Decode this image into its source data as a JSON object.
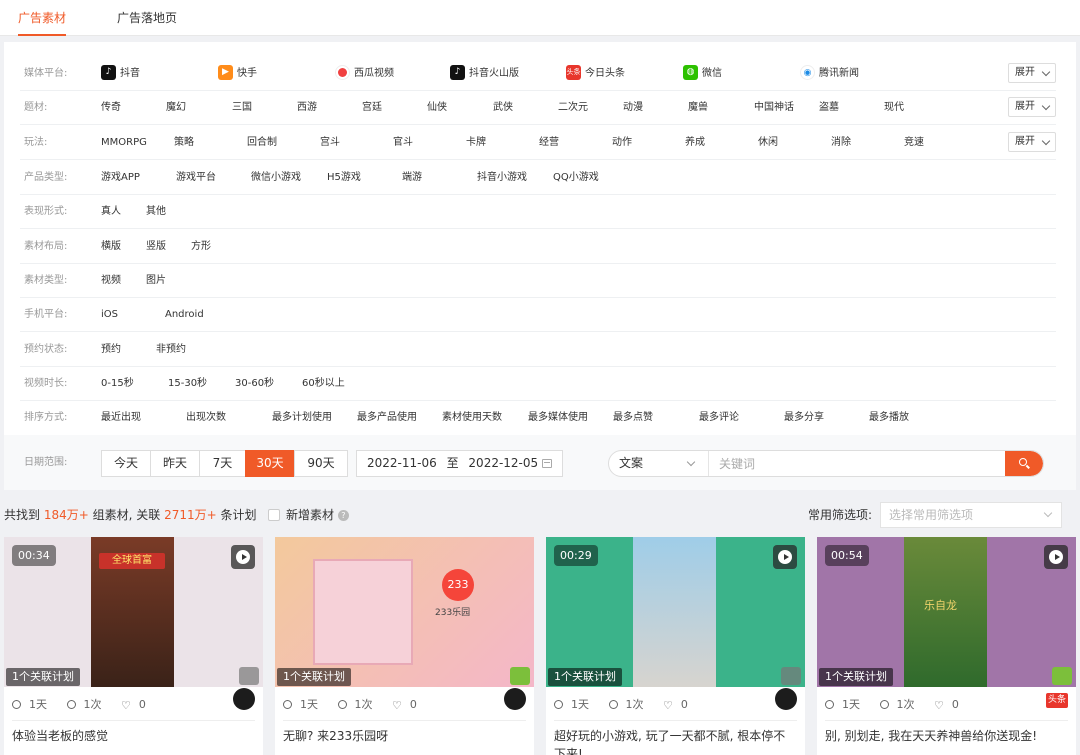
{
  "tabs": [
    {
      "label": "广告素材",
      "active": true
    },
    {
      "label": "广告落地页",
      "active": false
    }
  ],
  "filters": {
    "expand_label": "展开",
    "rows": [
      {
        "label": "媒体平台:",
        "options": [
          "抖音",
          "快手",
          "西瓜视频",
          "抖音火山版",
          "今日头条",
          "微信",
          "腾讯新闻"
        ],
        "icons": [
          "douyin-icon",
          "kuaishou-icon",
          "xigua-icon",
          "huoshan-icon",
          "toutiao-icon",
          "wechat-icon",
          "tencent-news-icon"
        ],
        "expandable": true
      },
      {
        "label": "题材:",
        "options": [
          "传奇",
          "魔幻",
          "三国",
          "西游",
          "宫廷",
          "仙侠",
          "武侠",
          "二次元",
          "动漫",
          "魔兽",
          "中国神话",
          "盗墓",
          "现代"
        ],
        "expandable": true
      },
      {
        "label": "玩法:",
        "options": [
          "MMORPG",
          "策略",
          "回合制",
          "宫斗",
          "官斗",
          "卡牌",
          "经营",
          "动作",
          "养成",
          "休闲",
          "消除",
          "竞速"
        ],
        "expandable": true
      },
      {
        "label": "产品类型:",
        "options": [
          "游戏APP",
          "游戏平台",
          "微信小游戏",
          "H5游戏",
          "端游",
          "抖音小游戏",
          "QQ小游戏"
        ]
      },
      {
        "label": "表现形式:",
        "options": [
          "真人",
          "其他"
        ]
      },
      {
        "label": "素材布局:",
        "options": [
          "横版",
          "竖版",
          "方形"
        ]
      },
      {
        "label": "素材类型:",
        "options": [
          "视频",
          "图片"
        ]
      },
      {
        "label": "手机平台:",
        "options": [
          "iOS",
          "Android"
        ]
      },
      {
        "label": "预约状态:",
        "options": [
          "预约",
          "非预约"
        ]
      },
      {
        "label": "视频时长:",
        "options": [
          "0-15秒",
          "15-30秒",
          "30-60秒",
          "60秒以上"
        ]
      },
      {
        "label": "排序方式:",
        "options": [
          "最近出现",
          "出现次数",
          "最多计划使用",
          "最多产品使用",
          "素材使用天数",
          "最多媒体使用",
          "最多点赞",
          "最多评论",
          "最多分享",
          "最多播放"
        ]
      }
    ]
  },
  "date": {
    "label": "日期范围:",
    "buttons": [
      "今天",
      "昨天",
      "7天",
      "30天",
      "90天"
    ],
    "active": "30天",
    "start": "2022-11-06",
    "to": "至",
    "end": "2022-12-05"
  },
  "search": {
    "type": "文案",
    "placeholder": "关键词"
  },
  "stats": {
    "prefix": "共找到",
    "count": "184万+",
    "mid": "组素材, 关联",
    "plans": "2711万+",
    "suffix": "条计划",
    "new_label": "新增素材",
    "common_label": "常用筛选项:",
    "common_placeholder": "选择常用筛选项"
  },
  "cards": [
    {
      "duration": "00:34",
      "plan": "1个关联计划",
      "os": "ios",
      "days": "1天",
      "times": "1次",
      "likes": "0",
      "channel": "xigua",
      "title": "体验当老板的感觉",
      "thumb_text": "全球首富",
      "bg": "#e9e2e6",
      "inner": "#6b3a2b"
    },
    {
      "duration": "",
      "plan": "1个关联计划",
      "os": "android",
      "days": "1天",
      "times": "1次",
      "likes": "0",
      "channel": "xigua",
      "title": "无聊? 来233乐园呀",
      "thumb_text": "233乐园",
      "bg": "#f3c79c",
      "inner": "#f6c6cf"
    },
    {
      "duration": "00:29",
      "plan": "1个关联计划",
      "os": "ios",
      "days": "1天",
      "times": "1次",
      "likes": "0",
      "channel": "xigua",
      "title": "超好玩的小游戏, 玩了一天都不腻, 根本停不下来!",
      "thumb_text": "",
      "bg": "#3db48a",
      "inner": "#9fd0ea"
    },
    {
      "duration": "00:54",
      "plan": "1个关联计划",
      "os": "android",
      "days": "1天",
      "times": "1次",
      "likes": "0",
      "channel": "toutiao",
      "title": "别, 别划走, 我在天天养神兽给你送现金!",
      "thumb_text": "乐自龙",
      "bg": "#a274a8",
      "inner": "#3f7d3a"
    }
  ],
  "channel_toutiao_label": "头条"
}
